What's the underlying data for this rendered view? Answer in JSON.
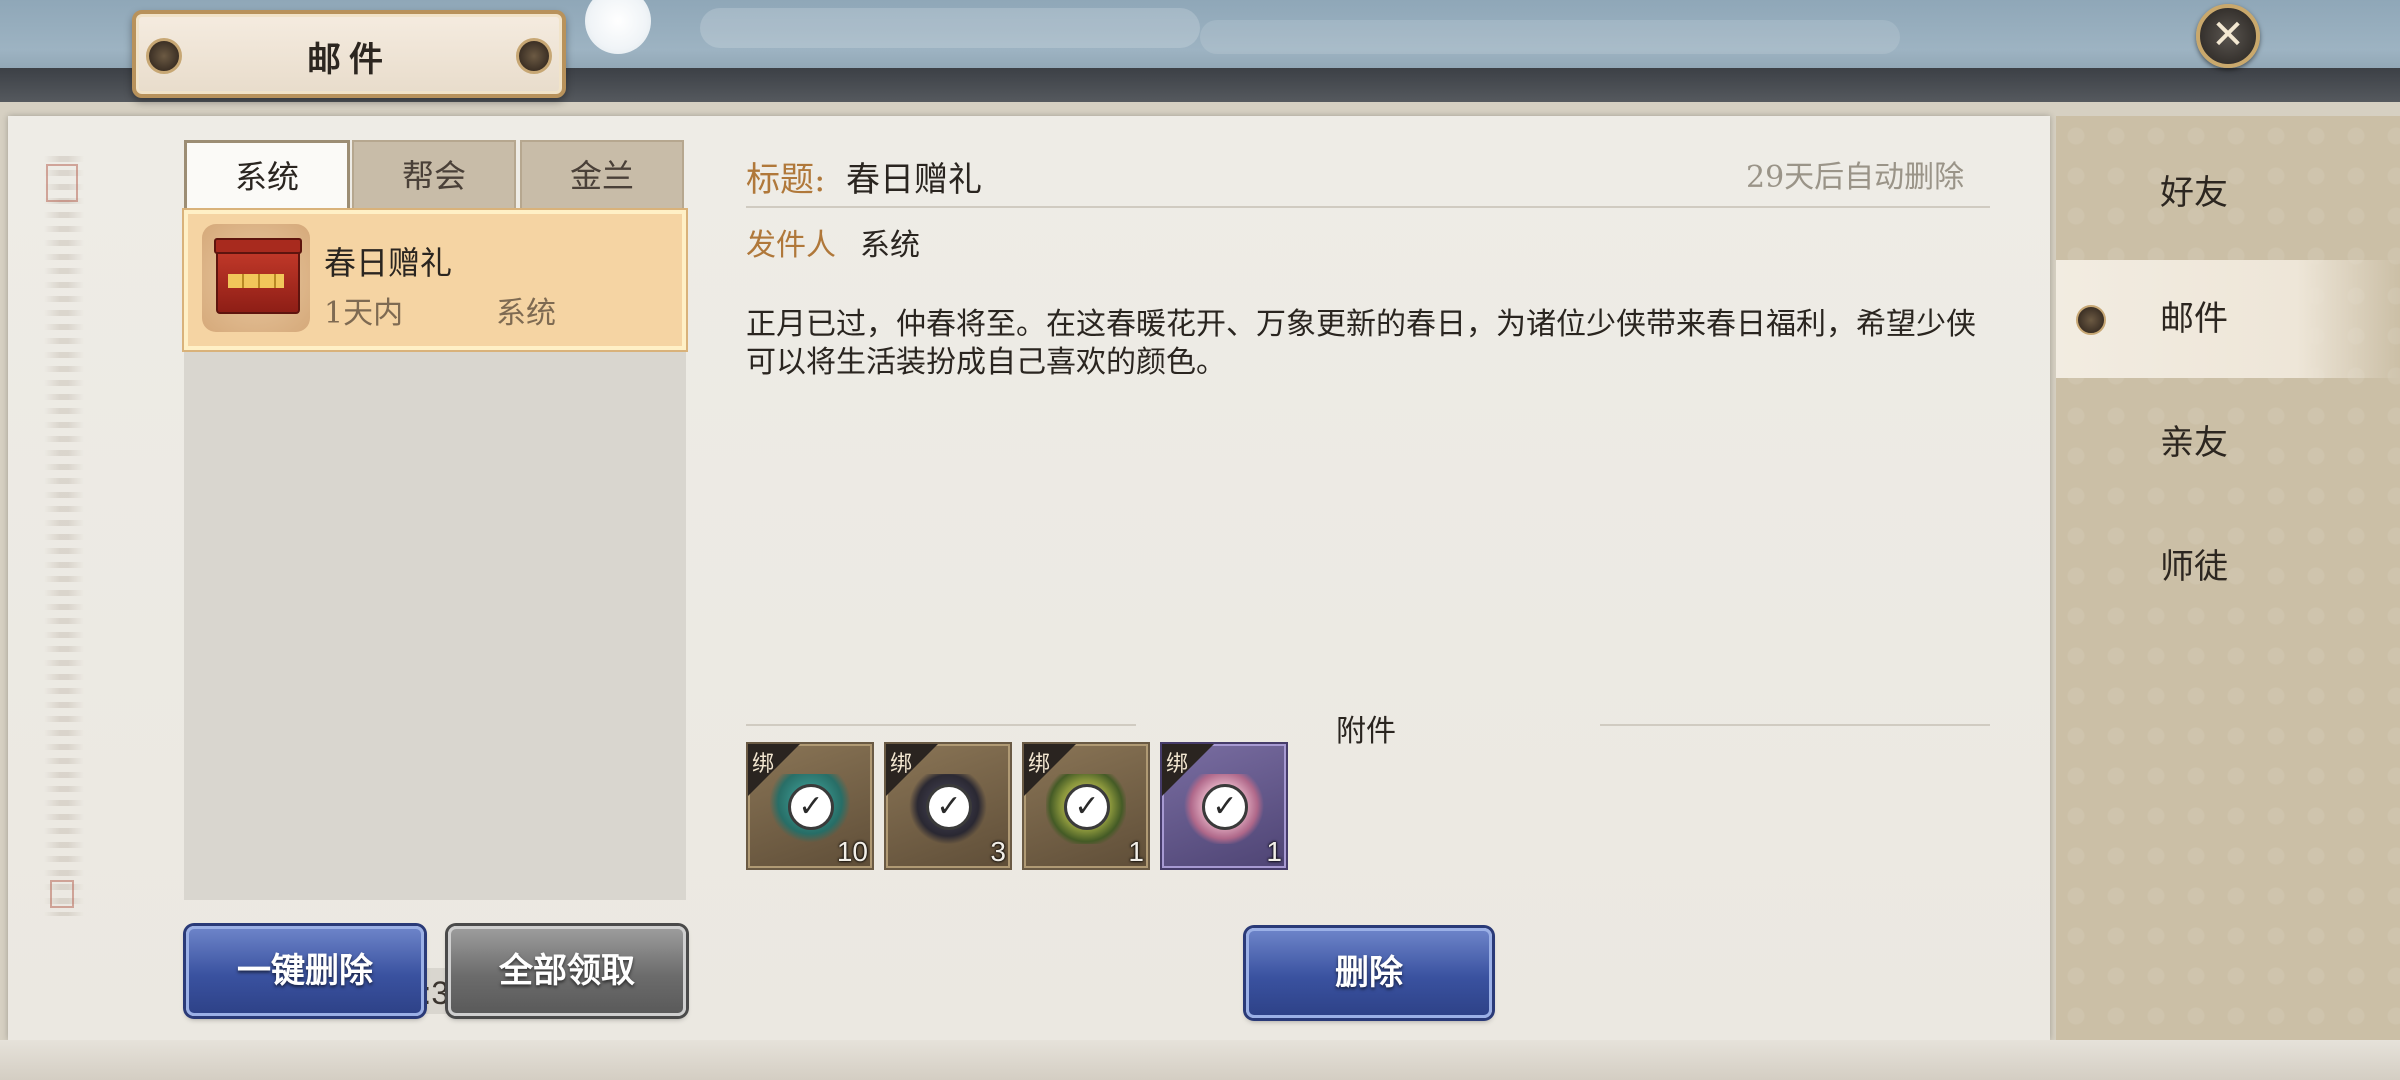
{
  "header": {
    "title": "邮件",
    "close_icon": "close-x-icon"
  },
  "tabs": [
    {
      "label": "系统",
      "active": true
    },
    {
      "label": "帮会",
      "active": false
    },
    {
      "label": "金兰",
      "active": false
    }
  ],
  "mail_list": {
    "items": [
      {
        "title": "春日赠礼",
        "time": "1天内",
        "sender": "系统",
        "icon": "gift-box-icon",
        "selected": true
      }
    ],
    "count_text": "邮件:3/200"
  },
  "buttons": {
    "delete_all": "一键删除",
    "claim_all": "全部领取",
    "delete": "删除"
  },
  "detail": {
    "title_label": "标题:",
    "title": "春日赠礼",
    "expire_text": "29天后自动删除",
    "sender_label": "发件人",
    "sender": "系统",
    "body": "正月已过，仲春将至。在这春暖花开、万象更新的春日，为诸位少侠带来春日福利，希望少侠可以将生活装扮成自己喜欢的颜色。",
    "attachments_label": "附件",
    "attachments": [
      {
        "bind_tag": "绑",
        "quantity": "10",
        "icon": "teal-chest-icon",
        "claimed": true
      },
      {
        "bind_tag": "绑",
        "quantity": "3",
        "icon": "dark-chest-icon",
        "claimed": true
      },
      {
        "bind_tag": "绑",
        "quantity": "1",
        "icon": "glowing-gem-icon",
        "claimed": true
      },
      {
        "bind_tag": "绑",
        "quantity": "1",
        "icon": "lotus-icon",
        "claimed": true
      }
    ]
  },
  "right_nav": [
    {
      "label": "好友",
      "active": false
    },
    {
      "label": "邮件",
      "active": true
    },
    {
      "label": "亲友",
      "active": false
    },
    {
      "label": "师徒",
      "active": false
    }
  ],
  "colors": {
    "accent_label": "#b0783a",
    "selected_mail": "#f5d4a3",
    "button_blue": "#3a52a0",
    "button_grey": "#6c6c6c"
  }
}
